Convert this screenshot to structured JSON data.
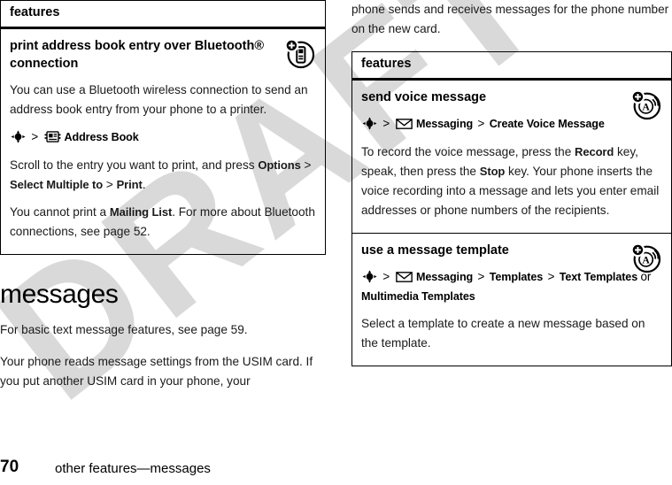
{
  "document": {
    "watermark": "DRAFT",
    "watermark_color": "#d9d9d9",
    "page_number": "70",
    "footer_title": "other features—messages"
  },
  "left_column": {
    "table": {
      "header": "features",
      "rows": [
        {
          "title": "print address book entry over Bluetooth® connection",
          "icon": "print-over-bluetooth-icon",
          "blocks": [
            {
              "kind": "body",
              "text": "You can use a Bluetooth wireless connection to send an address book entry from your phone to a printer."
            },
            {
              "kind": "nav",
              "parts": [
                {
                  "type": "icon",
                  "name": "joystick-icon"
                },
                {
                  "type": "sep",
                  "text": ">"
                },
                {
                  "type": "icon",
                  "name": "address-book-icon"
                },
                {
                  "type": "key",
                  "text": "Address Book"
                }
              ]
            },
            {
              "kind": "mixed",
              "segments": [
                {
                  "type": "text",
                  "text": "Scroll to the entry you want to print, and press "
                },
                {
                  "type": "key",
                  "text": "Options"
                },
                {
                  "type": "text",
                  "text": " > "
                },
                {
                  "type": "key",
                  "text": "Select Multiple to"
                },
                {
                  "type": "text",
                  "text": " > "
                },
                {
                  "type": "key",
                  "text": "Print"
                },
                {
                  "type": "text",
                  "text": "."
                }
              ]
            },
            {
              "kind": "mixed",
              "segments": [
                {
                  "type": "text",
                  "text": "You cannot print a "
                },
                {
                  "type": "key",
                  "text": "Mailing List"
                },
                {
                  "type": "text",
                  "text": ". For more about Bluetooth connections, see page 52."
                }
              ]
            }
          ]
        }
      ]
    },
    "section": {
      "heading": "messages",
      "paragraphs": [
        "For basic text message features, see page 59.",
        "Your phone reads message settings from the USIM card. If you put another USIM card in your phone, your"
      ]
    }
  },
  "right_column": {
    "intro_paragraph": "phone sends and receives messages for the phone number on the new card.",
    "table": {
      "header": "features",
      "rows": [
        {
          "title": "send voice message",
          "icon": "voice-message-icon",
          "blocks": [
            {
              "kind": "nav",
              "parts": [
                {
                  "type": "icon",
                  "name": "joystick-icon"
                },
                {
                  "type": "sep",
                  "text": ">"
                },
                {
                  "type": "icon",
                  "name": "envelope-icon"
                },
                {
                  "type": "key",
                  "text": "Messaging"
                },
                {
                  "type": "sep",
                  "text": ">"
                },
                {
                  "type": "key",
                  "text": "Create Voice Message"
                }
              ]
            },
            {
              "kind": "mixed",
              "segments": [
                {
                  "type": "text",
                  "text": "To record the voice message, press the "
                },
                {
                  "type": "key",
                  "text": "Record"
                },
                {
                  "type": "text",
                  "text": " key, speak, then press the "
                },
                {
                  "type": "key",
                  "text": "Stop"
                },
                {
                  "type": "text",
                  "text": " key. Your phone inserts the voice recording into a message and lets you enter email addresses or phone numbers of the recipients."
                }
              ]
            }
          ]
        },
        {
          "title": "use a message template",
          "icon": "message-template-icon",
          "blocks": [
            {
              "kind": "nav",
              "parts": [
                {
                  "type": "icon",
                  "name": "joystick-icon"
                },
                {
                  "type": "sep",
                  "text": ">"
                },
                {
                  "type": "icon",
                  "name": "envelope-icon"
                },
                {
                  "type": "key",
                  "text": "Messaging"
                },
                {
                  "type": "sep",
                  "text": ">"
                },
                {
                  "type": "key",
                  "text": "Templates"
                },
                {
                  "type": "sep",
                  "text": ">"
                },
                {
                  "type": "key",
                  "text": "Text Templates"
                },
                {
                  "type": "plain",
                  "text": "or"
                },
                {
                  "type": "key",
                  "text": "Multimedia Templates"
                }
              ]
            },
            {
              "kind": "body",
              "text": "Select a template to create a new message based on the template."
            }
          ]
        }
      ]
    }
  }
}
